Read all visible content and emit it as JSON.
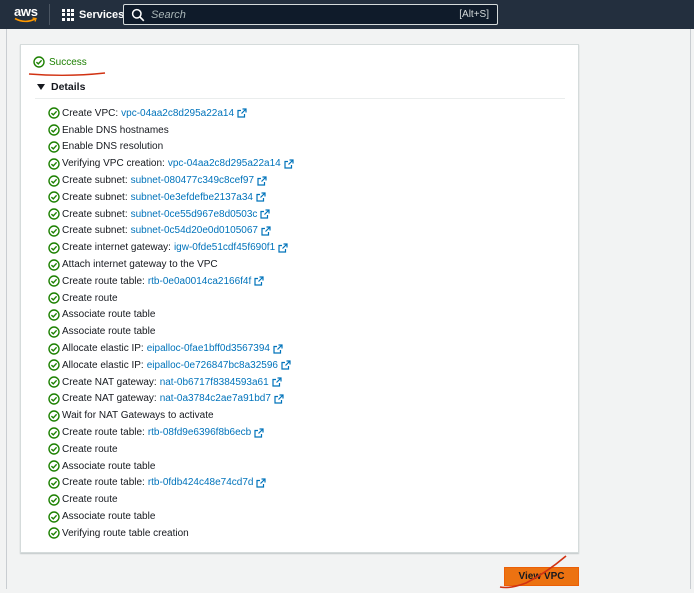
{
  "header": {
    "logo_text": "aws",
    "services_label": "Services",
    "search_placeholder": "Search",
    "search_shortcut": "[Alt+S]"
  },
  "status": {
    "success_label": "Success",
    "success_color": "#1d8102"
  },
  "details": {
    "title": "Details",
    "steps": [
      {
        "text": "Create VPC:",
        "link": "vpc-04aa2c8d295a22a14"
      },
      {
        "text": "Enable DNS hostnames"
      },
      {
        "text": "Enable DNS resolution"
      },
      {
        "text": "Verifying VPC creation:",
        "link": "vpc-04aa2c8d295a22a14"
      },
      {
        "text": "Create subnet:",
        "link": "subnet-080477c349c8cef97"
      },
      {
        "text": "Create subnet:",
        "link": "subnet-0e3efdefbe2137a34"
      },
      {
        "text": "Create subnet:",
        "link": "subnet-0ce55d967e8d0503c"
      },
      {
        "text": "Create subnet:",
        "link": "subnet-0c54d20e0d0105067"
      },
      {
        "text": "Create internet gateway:",
        "link": "igw-0fde51cdf45f690f1"
      },
      {
        "text": "Attach internet gateway to the VPC"
      },
      {
        "text": "Create route table:",
        "link": "rtb-0e0a0014ca2166f4f"
      },
      {
        "text": "Create route"
      },
      {
        "text": "Associate route table"
      },
      {
        "text": "Associate route table"
      },
      {
        "text": "Allocate elastic IP:",
        "link": "eipalloc-0fae1bff0d3567394"
      },
      {
        "text": "Allocate elastic IP:",
        "link": "eipalloc-0e726847bc8a32596"
      },
      {
        "text": "Create NAT gateway:",
        "link": "nat-0b6717f8384593a61"
      },
      {
        "text": "Create NAT gateway:",
        "link": "nat-0a3784c2ae7a91bd7"
      },
      {
        "text": "Wait for NAT Gateways to activate"
      },
      {
        "text": "Create route table:",
        "link": "rtb-08fd9e6396f8b6ecb"
      },
      {
        "text": "Create route"
      },
      {
        "text": "Associate route table"
      },
      {
        "text": "Create route table:",
        "link": "rtb-0fdb424c48e74cd7d"
      },
      {
        "text": "Create route"
      },
      {
        "text": "Associate route table"
      },
      {
        "text": "Verifying route table creation"
      }
    ]
  },
  "actions": {
    "view_vpc_label": "View VPC",
    "primary_color": "#ec7211"
  },
  "icons": {
    "check": "check-circle-icon",
    "external": "external-link-icon",
    "search": "search-icon",
    "services": "grid-icon",
    "logo": "aws-logo"
  },
  "colors": {
    "topbar": "#232f3e",
    "link": "#0073bb",
    "annotation": "#d13212"
  }
}
